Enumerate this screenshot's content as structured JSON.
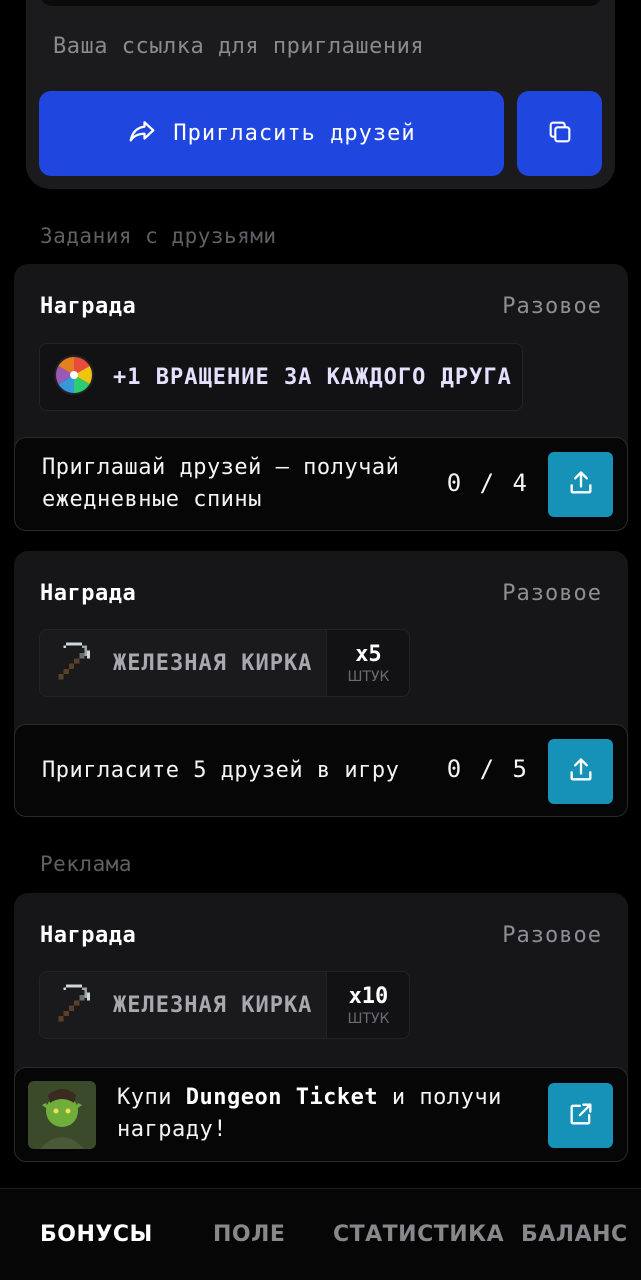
{
  "invite": {
    "link_placeholder": "Ваша ссылка для приглашения",
    "invite_button_label": "Пригласить друзей",
    "share_icon": "share-arrow-icon",
    "copy_icon": "copy-icon",
    "accent_color": "#1f47e0"
  },
  "sections": {
    "friends_tasks_title": "Задания с друзьями",
    "ads_title": "Реклама"
  },
  "tasks": [
    {
      "reward_label": "Награда",
      "reward_type": "Разовое",
      "reward_text": "+1 ВРАЩЕНИЕ ЗА КАЖДОГО ДРУГА",
      "reward_icon": "wheel-icon",
      "description": "Приглашай друзей – получай ежедневные спины",
      "progress_current": "0",
      "progress_sep": "/",
      "progress_total": "4",
      "action_icon": "upload-share-icon"
    },
    {
      "reward_label": "Награда",
      "reward_type": "Разовое",
      "reward_text": "ЖЕЛЕЗНАЯ КИРКА",
      "reward_icon": "pickaxe-icon",
      "quantity": "x5",
      "quantity_unit": "ШТУК",
      "description": "Пригласите 5 друзей в игру",
      "progress_current": "0",
      "progress_sep": "/",
      "progress_total": "5",
      "action_icon": "upload-share-icon"
    },
    {
      "reward_label": "Награда",
      "reward_type": "Разовое",
      "reward_text": "ЖЕЛЕЗНАЯ КИРКА",
      "reward_icon": "pickaxe-icon",
      "quantity": "x10",
      "quantity_unit": "ШТУК",
      "description_pre": "Купи ",
      "description_bold": "Dungeon Ticket",
      "description_post": " и получи награду!",
      "action_icon": "external-link-icon"
    }
  ],
  "nav": {
    "items": [
      "БОНУСЫ",
      "ПОЛЕ",
      "СТАТИСТИКА",
      "БАЛАНС"
    ],
    "active": "БОНУСЫ"
  },
  "colors": {
    "task_button": "#1692b8",
    "card": "#161618"
  }
}
